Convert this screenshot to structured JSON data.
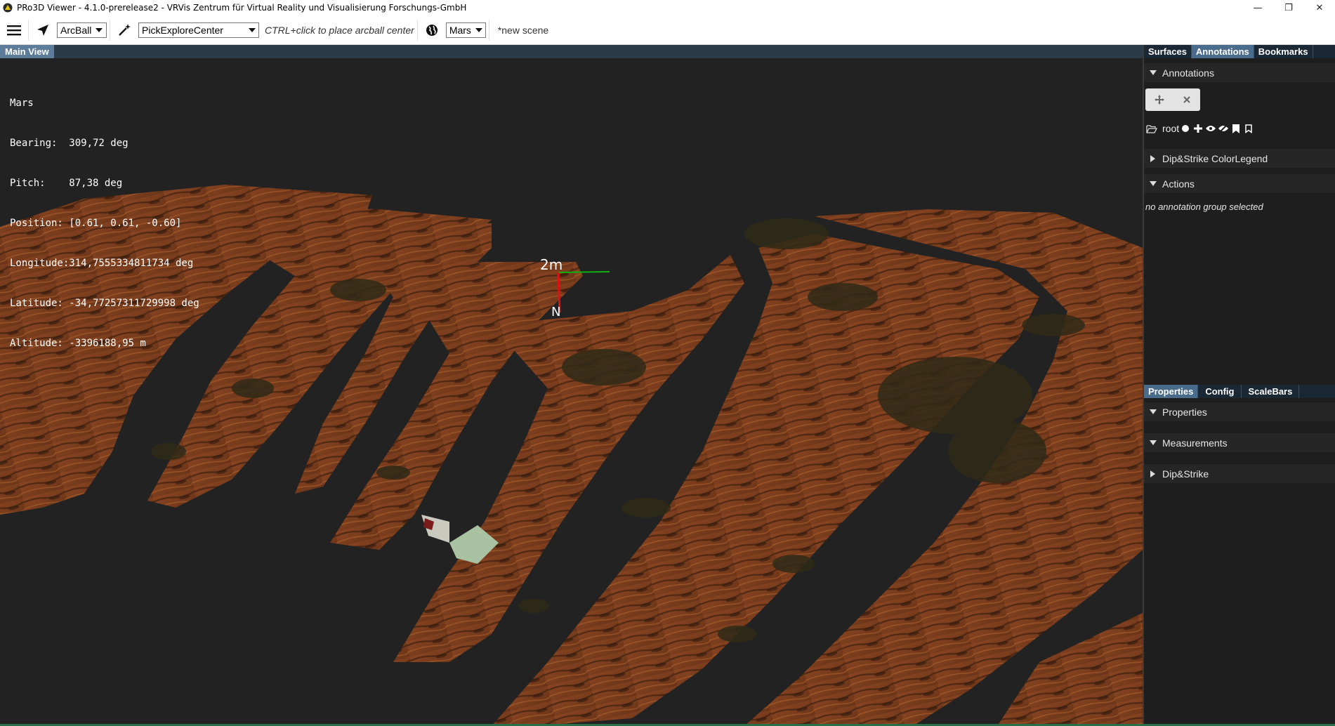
{
  "window": {
    "title": "PRo3D Viewer - 4.1.0-prerelease2 - VRVis Zentrum für Virtual Reality und Visualisierung Forschungs-GmbH",
    "minimize": "—",
    "restore": "❐",
    "close": "✕"
  },
  "toolbar": {
    "navigation_mode": "ArcBall",
    "interaction_mode": "PickExploreCenter",
    "hint": "CTRL+click to place arcball center",
    "planet": "Mars",
    "scene_name": "*new scene"
  },
  "main_view": {
    "tab_label": "Main View",
    "info_lines": [
      "Mars",
      "Bearing:  309,72 deg",
      "Pitch:    87,38 deg",
      "Position: [0.61, 0.61, -0.60]",
      "Longitude:314,7555334811734 deg",
      "Latitude: -34,77257311729998 deg",
      "Altitude: -3396188,95 m"
    ],
    "scale_label": "2m",
    "north_label": "N"
  },
  "right_panel": {
    "top_tabs": [
      "Surfaces",
      "Annotations",
      "Bookmarks"
    ],
    "top_active": "Annotations",
    "annotations_header": "Annotations",
    "root_label": "root",
    "dip_strike_legend": "Dip&Strike ColorLegend",
    "actions_header": "Actions",
    "no_group_text": "no annotation group selected",
    "bottom_tabs": [
      "Properties",
      "Config",
      "ScaleBars"
    ],
    "bottom_active": "Properties",
    "properties_header": "Properties",
    "measurements_header": "Measurements",
    "dip_strike_header": "Dip&Strike"
  },
  "colors": {
    "scene_background": "#222222",
    "terrain_base": "#7a3e1e",
    "terrain_light": "#a4562a",
    "terrain_dark": "#3a1f10",
    "tab_active": "#4a6c8c",
    "tab_bar": "#1a2735",
    "axis_red": "#e01010",
    "axis_green": "#10b010"
  }
}
